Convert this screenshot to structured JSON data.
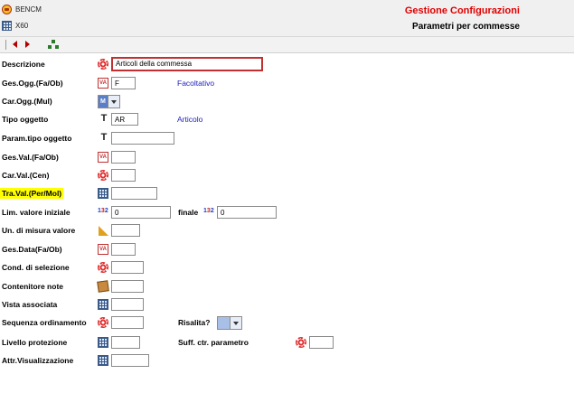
{
  "app": {
    "name": "BENCM",
    "window": "X60"
  },
  "header": {
    "title": "Gestione Configurazioni",
    "subtitle": "Parametri per commesse"
  },
  "form": {
    "descrizione": {
      "label": "Descrizione",
      "value": "Articoli della commessa"
    },
    "gesOgg": {
      "label": "Ges.Ogg.(Fa/Ob)",
      "value": "F",
      "hint": "Facoltativo"
    },
    "carOgg": {
      "label": "Car.Ogg.(Mul)",
      "selected": "M"
    },
    "tipoOggetto": {
      "label": "Tipo oggetto",
      "value": "AR",
      "hint": "Articolo"
    },
    "paramTipo": {
      "label": "Param.tipo oggetto",
      "value": ""
    },
    "gesVal": {
      "label": "Ges.Val.(Fa/Ob)",
      "value": ""
    },
    "carVal": {
      "label": "Car.Val.(Cen)",
      "value": ""
    },
    "traVal": {
      "label": "Tra.Val.(Per/Mol)",
      "value": ""
    },
    "limValore": {
      "label": "Lim. valore iniziale",
      "value": "0",
      "finale_label": "finale",
      "finale_value": "0"
    },
    "unMisura": {
      "label": "Un. di misura valore",
      "value": ""
    },
    "gesData": {
      "label": "Ges.Data(Fa/Ob)",
      "value": ""
    },
    "condSelezione": {
      "label": "Cond. di selezione",
      "value": ""
    },
    "contenitoreNote": {
      "label": "Contenitore note",
      "value": ""
    },
    "vistaAssociata": {
      "label": "Vista associata",
      "value": ""
    },
    "sequenza": {
      "label": "Sequenza ordinamento",
      "value": "",
      "risalita_label": "Risalita?",
      "risalita_selected": ""
    },
    "livelloProtezione": {
      "label": "Livello protezione",
      "value": "",
      "suff_label": "Suff. ctr. parametro",
      "suff_value": ""
    },
    "attrVisual": {
      "label": "Attr.Visualizzazione",
      "value": ""
    }
  }
}
